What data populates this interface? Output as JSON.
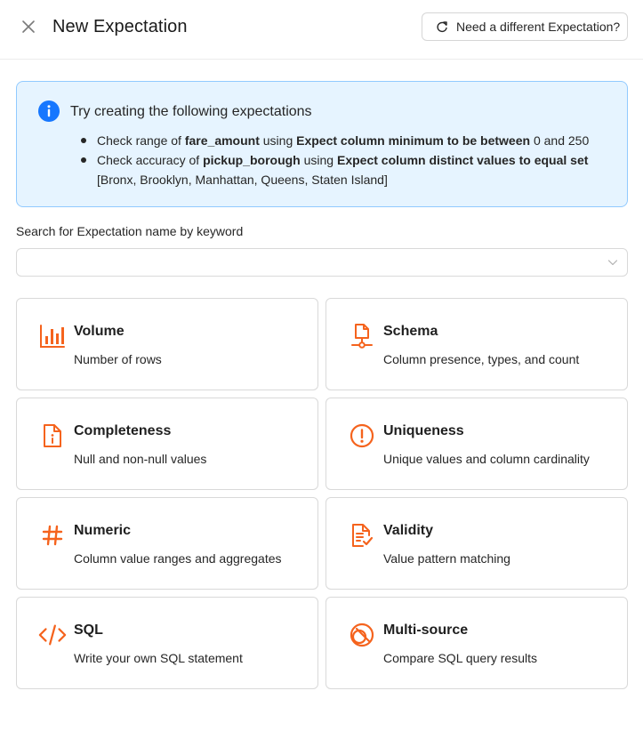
{
  "header": {
    "title": "New Expectation",
    "different_button_label": "Need a different Expectation?"
  },
  "info": {
    "title": "Try creating the following expectations",
    "items": [
      {
        "prefix": "Check range of ",
        "column": "fare_amount",
        "middle": " using ",
        "expectation": "Expect column minimum to be between",
        "suffix": " 0 and 250"
      },
      {
        "prefix": "Check accuracy of ",
        "column": "pickup_borough",
        "middle": " using ",
        "expectation": "Expect column distinct values to equal set",
        "suffix": " [Bronx, Brooklyn, Manhattan, Queens, Staten Island]"
      }
    ]
  },
  "search": {
    "label": "Search for Expectation name by keyword",
    "value": "",
    "placeholder": ""
  },
  "categories": [
    {
      "title": "Volume",
      "description": "Number of rows",
      "icon": "bar-chart-icon"
    },
    {
      "title": "Schema",
      "description": "Column presence, types, and count",
      "icon": "schema-icon"
    },
    {
      "title": "Completeness",
      "description": "Null and non-null values",
      "icon": "file-info-icon"
    },
    {
      "title": "Uniqueness",
      "description": "Unique values and column cardinality",
      "icon": "exclamation-circle-icon"
    },
    {
      "title": "Numeric",
      "description": "Column value ranges and aggregates",
      "icon": "hash-icon"
    },
    {
      "title": "Validity",
      "description": "Value pattern matching",
      "icon": "file-check-icon"
    },
    {
      "title": "SQL",
      "description": "Write your own SQL statement",
      "icon": "code-icon"
    },
    {
      "title": "Multi-source",
      "description": "Compare SQL query results",
      "icon": "multi-source-icon"
    }
  ],
  "colors": {
    "accent": "#f5631d",
    "info_bg": "#e6f4ff",
    "info_border": "#91caff",
    "info_icon": "#1677ff"
  }
}
